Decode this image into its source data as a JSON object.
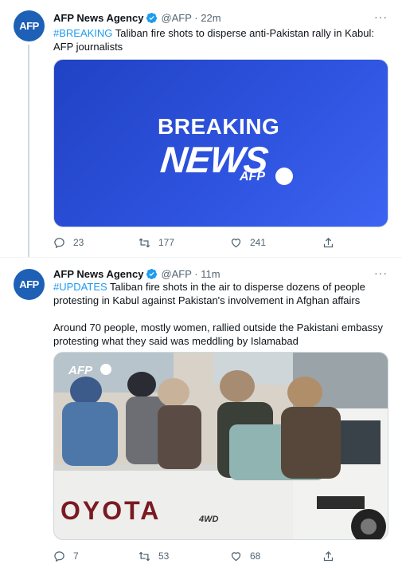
{
  "tweets": [
    {
      "avatar_text": "AFP",
      "name": "AFP News Agency",
      "handle_time": "@AFP · 22m",
      "more": "···",
      "hashtag": "#BREAKING",
      "text": " Taliban fire shots to disperse anti-Pakistan rally in Kabul: AFP journalists",
      "media": {
        "breaking": "BREAKING",
        "news": "NEWS",
        "afp": "AFP"
      },
      "actions": {
        "replies": "23",
        "retweets": "177",
        "likes": "241"
      }
    },
    {
      "avatar_text": "AFP",
      "name": "AFP News Agency",
      "handle_time": "@AFP · 11m",
      "more": "···",
      "hashtag": "#UPDATES",
      "text": " Taliban fire shots in the air to disperse dozens of people protesting in Kabul against Pakistan's involvement in Afghan affairs",
      "text2": "Around 70 people, mostly women, rallied outside the Pakistani embassy protesting what they said was meddling by Islamabad",
      "media": {
        "logo": "AFP",
        "truck_text": "OYOTA",
        "badge": "4WD"
      },
      "actions": {
        "replies": "7",
        "retweets": "53",
        "likes": "68"
      }
    }
  ],
  "colors": {
    "accent": "#1d9bf0",
    "avatar_bg": "#1d60b6",
    "muted": "#536471"
  }
}
